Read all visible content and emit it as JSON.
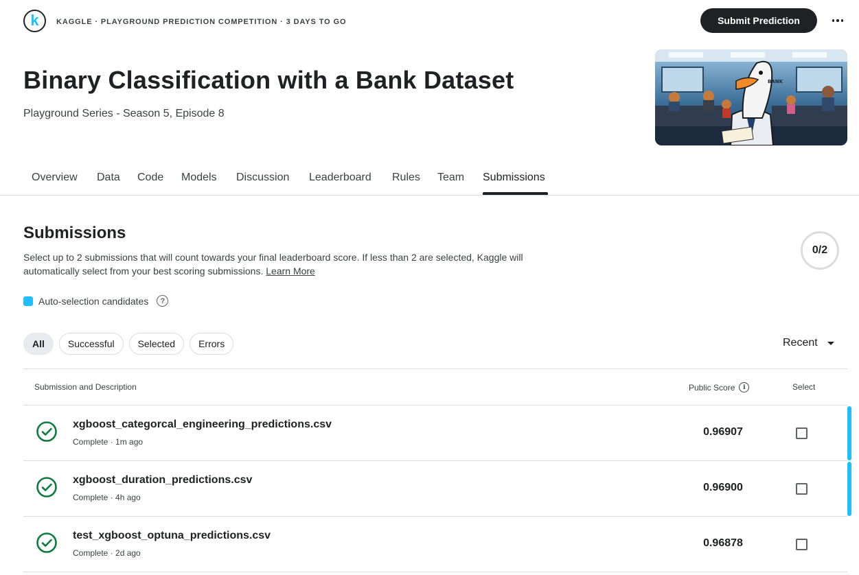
{
  "header": {
    "logo_letter": "k",
    "competition_meta": "KAGGLE · PLAYGROUND PREDICTION COMPETITION · 3 DAYS TO GO",
    "submit_label": "Submit Prediction",
    "more_icon": "more-horizontal-icon"
  },
  "competition": {
    "title": "Binary Classification with a Bank Dataset",
    "subtitle": "Playground Series - Season 5, Episode 8",
    "banner_text": "BANK"
  },
  "tabs": [
    {
      "label": "Overview"
    },
    {
      "label": "Data"
    },
    {
      "label": "Code"
    },
    {
      "label": "Models"
    },
    {
      "label": "Discussion"
    },
    {
      "label": "Leaderboard"
    },
    {
      "label": "Rules"
    },
    {
      "label": "Team"
    },
    {
      "label": "Submissions",
      "active": true
    }
  ],
  "submissions": {
    "heading": "Submissions",
    "description": "Select up to 2 submissions that will count towards your final leaderboard score. If less than 2 are selected, Kaggle will automatically select from your best scoring submissions.",
    "learn_more": "Learn More",
    "selected_count": "0/2",
    "legend_label": "Auto-selection candidates",
    "legend_color": "#20beff",
    "help_icon": "help-circle-icon",
    "filters": [
      {
        "label": "All",
        "active": true
      },
      {
        "label": "Successful"
      },
      {
        "label": "Selected"
      },
      {
        "label": "Errors"
      }
    ],
    "sort_label": "Recent",
    "columns": {
      "description": "Submission and Description",
      "score": "Public Score",
      "select": "Select"
    },
    "rows": [
      {
        "file": "xgboost_categorcal_engineering_predictions.csv",
        "status": "Complete · 1m ago",
        "score": "0.96907",
        "selected": false,
        "auto_candidate": true
      },
      {
        "file": "xgboost_duration_predictions.csv",
        "status": "Complete · 4h ago",
        "score": "0.96900",
        "selected": false,
        "auto_candidate": true
      },
      {
        "file": "test_xgboost_optuna_predictions.csv",
        "status": "Complete · 2d ago",
        "score": "0.96878",
        "selected": false,
        "auto_candidate": false
      }
    ]
  },
  "colors": {
    "accent": "#20beff",
    "success": "#0d7a3f",
    "dark": "#202124"
  }
}
